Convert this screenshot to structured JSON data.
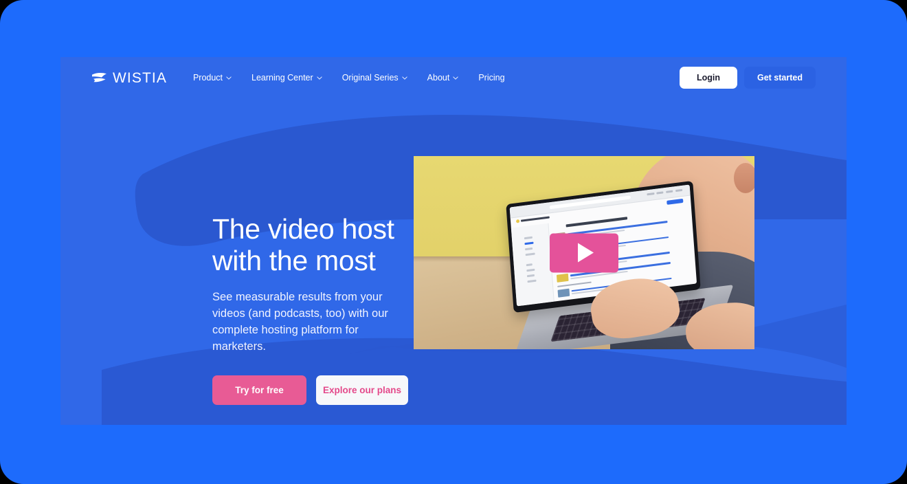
{
  "theme": {
    "outer_bg": "#1d6bfc",
    "hero_bg": "#3068e8",
    "swoosh": "#2a58d0",
    "accent_pink": "#e85b95",
    "link_pink": "#e4498a",
    "cta_blue": "#2b62e3"
  },
  "nav": {
    "logo_text": "WISTIA",
    "logo_icon": "wistia-flag-logo",
    "links": [
      {
        "label": "Product",
        "has_dropdown": true
      },
      {
        "label": "Learning Center",
        "has_dropdown": true
      },
      {
        "label": "Original Series",
        "has_dropdown": true
      },
      {
        "label": "About",
        "has_dropdown": true
      },
      {
        "label": "Pricing",
        "has_dropdown": false
      }
    ],
    "login_label": "Login",
    "get_started_label": "Get started"
  },
  "hero": {
    "headline_line1": "The video host",
    "headline_line2": "with the most",
    "subcopy": "See measurable results from your videos (and podcasts, too) with our complete hosting platform for marketers.",
    "cta_primary": "Try for free",
    "cta_secondary": "Explore our plans"
  },
  "video": {
    "play_icon": "play-triangle-icon",
    "scene_description": "Person typing on a MacBook showing the Wistia dashboard against a yellow wall on a wooden desk"
  }
}
